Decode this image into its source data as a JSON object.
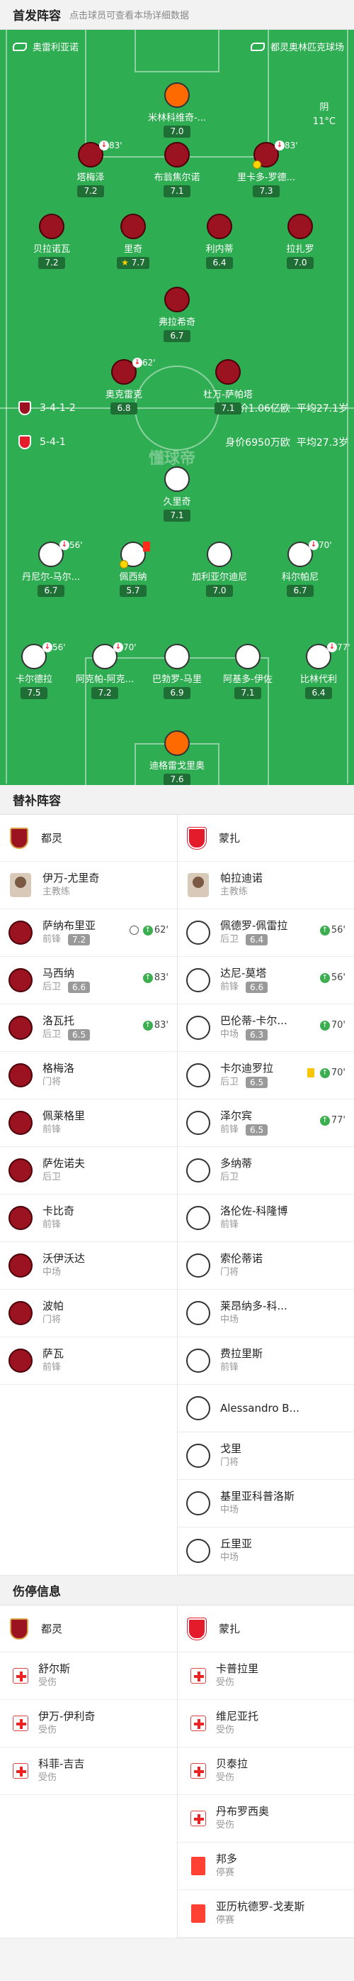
{
  "lineup_header": {
    "title": "首发阵容",
    "hint": "点击球员可查看本场详细数据"
  },
  "pitch": {
    "home_team": "奥雷利亚诺",
    "venue": "都灵奥林匹克球场",
    "weather": "阴",
    "temperature": "11°C",
    "watermark": "懂球帝"
  },
  "team_top": {
    "formation": "3-4-1-2",
    "value": "身价1.06亿欧",
    "avg_age": "平均27.1岁"
  },
  "team_bottom": {
    "formation": "5-4-1",
    "value": "身价6950万欧",
    "avg_age": "平均27.3岁"
  },
  "pitch_players": [
    {
      "name": "米林科维奇-...",
      "rating": "7.0",
      "kit": "orange"
    },
    {
      "name": "塔梅泽",
      "rating": "7.2",
      "kit": "red",
      "sub": "83'"
    },
    {
      "name": "布翁焦尔诺",
      "rating": "7.1",
      "kit": "red"
    },
    {
      "name": "里卡多-罗德...",
      "rating": "7.3",
      "kit": "red",
      "sub": "83'",
      "yellow": true
    },
    {
      "name": "贝拉诺瓦",
      "rating": "7.2",
      "kit": "red"
    },
    {
      "name": "里奇",
      "rating": "7.7",
      "kit": "red",
      "star": true
    },
    {
      "name": "利内蒂",
      "rating": "6.4",
      "kit": "red"
    },
    {
      "name": "拉扎罗",
      "rating": "7.0",
      "kit": "red"
    },
    {
      "name": "弗拉希奇",
      "rating": "6.7",
      "kit": "red"
    },
    {
      "name": "奥克雷克",
      "rating": "6.8",
      "kit": "red",
      "sub": "62'"
    },
    {
      "name": "杜万-萨帕塔",
      "rating": "7.1",
      "kit": "red"
    },
    {
      "name": "久里奇",
      "rating": "7.1",
      "kit": "white"
    },
    {
      "name": "丹尼尔-马尔...",
      "rating": "6.7",
      "kit": "white",
      "sub": "56'"
    },
    {
      "name": "佩西纳",
      "rating": "5.7",
      "kit": "white",
      "card": true,
      "yellow": true
    },
    {
      "name": "加利亚尔迪尼",
      "rating": "7.0",
      "kit": "white"
    },
    {
      "name": "科尔帕尼",
      "rating": "6.7",
      "kit": "white",
      "sub": "70'"
    },
    {
      "name": "卡尔德拉",
      "rating": "7.5",
      "kit": "white",
      "sub": "56'"
    },
    {
      "name": "阿克帕-阿克...",
      "rating": "7.2",
      "kit": "white",
      "sub": "70'"
    },
    {
      "name": "巴勃罗-马里",
      "rating": "6.9",
      "kit": "white"
    },
    {
      "name": "阿基多-伊佐",
      "rating": "7.1",
      "kit": "white"
    },
    {
      "name": "比林代利",
      "rating": "6.4",
      "kit": "white",
      "sub": "77'"
    },
    {
      "name": "迪格雷戈里奥",
      "rating": "7.6",
      "kit": "orange"
    }
  ],
  "subs_header": {
    "title": "替补阵容"
  },
  "subs": {
    "left_team": "都灵",
    "right_team": "蒙扎",
    "left_coach": {
      "name": "伊万-尤里奇",
      "role": "主教练"
    },
    "right_coach": {
      "name": "帕拉迪诺",
      "role": "主教练"
    },
    "left": [
      {
        "name": "萨纳布里亚",
        "pos": "前锋",
        "rating": "7.2",
        "goal": true,
        "sub": "62'"
      },
      {
        "name": "马西纳",
        "pos": "后卫",
        "rating": "6.6",
        "sub": "83'"
      },
      {
        "name": "洛瓦托",
        "pos": "后卫",
        "rating": "6.5",
        "sub": "83'"
      },
      {
        "name": "格梅洛",
        "pos": "门将"
      },
      {
        "name": "佩莱格里",
        "pos": "前锋"
      },
      {
        "name": "萨佐诺夫",
        "pos": "后卫"
      },
      {
        "name": "卡比奇",
        "pos": "前锋"
      },
      {
        "name": "沃伊沃达",
        "pos": "中场"
      },
      {
        "name": "波帕",
        "pos": "门将"
      },
      {
        "name": "萨瓦",
        "pos": "前锋"
      }
    ],
    "right": [
      {
        "name": "佩德罗-佩雷拉",
        "pos": "后卫",
        "rating": "6.4",
        "sub": "56'"
      },
      {
        "name": "达尼-莫塔",
        "pos": "前锋",
        "rating": "6.6",
        "sub": "56'"
      },
      {
        "name": "巴伦蒂-卡尔...",
        "pos": "中场",
        "rating": "6.3",
        "sub": "70'"
      },
      {
        "name": "卡尔迪罗拉",
        "pos": "后卫",
        "rating": "6.5",
        "yellow": true,
        "sub": "70'"
      },
      {
        "name": "泽尔宾",
        "pos": "前锋",
        "rating": "6.5",
        "sub": "77'"
      },
      {
        "name": "多纳蒂",
        "pos": "后卫"
      },
      {
        "name": "洛伦佐-科隆博",
        "pos": "前锋"
      },
      {
        "name": "索伦蒂诺",
        "pos": "门将"
      },
      {
        "name": "莱昂纳多-科...",
        "pos": "中场"
      },
      {
        "name": "费拉里斯",
        "pos": "前锋"
      },
      {
        "name": "Alessandro B...",
        "pos": ""
      },
      {
        "name": "戈里",
        "pos": "门将"
      },
      {
        "name": "基里亚科普洛斯",
        "pos": "中场"
      },
      {
        "name": "丘里亚",
        "pos": "中场"
      }
    ]
  },
  "injury_header": {
    "title": "伤停信息"
  },
  "injuries": {
    "left_team": "都灵",
    "right_team": "蒙扎",
    "left": [
      {
        "name": "舒尔斯",
        "status": "受伤",
        "type": "injury"
      },
      {
        "name": "伊万-伊利奇",
        "status": "受伤",
        "type": "injury"
      },
      {
        "name": "科菲-吉吉",
        "status": "受伤",
        "type": "injury"
      }
    ],
    "right": [
      {
        "name": "卡普拉里",
        "status": "受伤",
        "type": "injury"
      },
      {
        "name": "维尼亚托",
        "status": "受伤",
        "type": "injury"
      },
      {
        "name": "贝泰拉",
        "status": "受伤",
        "type": "injury"
      },
      {
        "name": "丹布罗西奥",
        "status": "受伤",
        "type": "injury"
      },
      {
        "name": "邦多",
        "status": "停赛",
        "type": "suspension"
      },
      {
        "name": "亚历杭德罗-戈麦斯",
        "status": "停赛",
        "type": "suspension"
      }
    ]
  }
}
